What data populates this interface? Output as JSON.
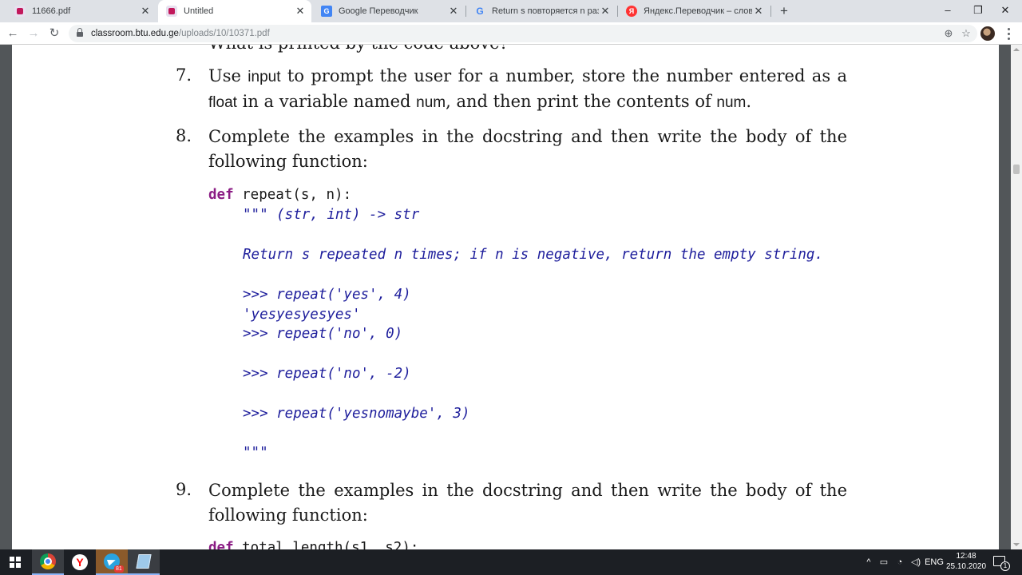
{
  "tabs": [
    {
      "title": "11666.pdf",
      "icon": "pdf-icon",
      "active": false
    },
    {
      "title": "Untitled",
      "icon": "pdf-icon",
      "active": true
    },
    {
      "title": "Google Переводчик",
      "icon": "google-translate-icon",
      "active": false
    },
    {
      "title": "Return s повторяется n раз; если",
      "icon": "google-icon",
      "active": false
    },
    {
      "title": "Яндекс.Переводчик – словарь и",
      "icon": "yandex-translate-icon",
      "active": false
    }
  ],
  "window_controls": {
    "minimize": "–",
    "maximize": "❐",
    "close": "✕"
  },
  "toolbar": {
    "back": "←",
    "forward": "→",
    "reload": "↻",
    "url_host": "classroom.btu.edu.ge",
    "url_path": "/uploads/10/10371.pdf",
    "zoom_icon": "⊕",
    "star_icon": "☆"
  },
  "document": {
    "cut_line": "What is printed by the code above?",
    "item7": {
      "number": "7.",
      "t1": "Use ",
      "c1": "input",
      "t2": " to prompt the user for a number, store the number entered as a ",
      "c2": "float",
      "t3": " in a variable named ",
      "c3": "num",
      "t4": ", and then print the contents of ",
      "c4": "num",
      "t5": "."
    },
    "item8": {
      "number": "8.",
      "text": "Complete the examples in the docstring and then write the body of the following function:",
      "code": {
        "def_kw": "def",
        "signature": " repeat(s, n):",
        "doc_open": "\"\"\" (str, int) -> str",
        "doc_desc": "Return s repeated n times; if n is negative, return the empty string.",
        "ex1": ">>> repeat('yes', 4)",
        "ex1_result": "'yesyesyesyes'",
        "ex2": ">>> repeat('no', 0)",
        "ex3": ">>> repeat('no', -2)",
        "ex4": ">>> repeat('yesnomaybe', 3)",
        "doc_close": "\"\"\""
      }
    },
    "item9": {
      "number": "9.",
      "text": "Complete the examples in the docstring and then write the body of the following function:",
      "code_def_kw": "def",
      "code_signature": " total_length(s1, s2):"
    }
  },
  "taskbar": {
    "apps": [
      "chrome-icon",
      "yandex-browser-icon",
      "telegram-icon",
      "sticky-notes-icon"
    ],
    "telegram_badge": "81",
    "language": "ENG",
    "time": "12:48",
    "date": "25.10.2020",
    "notification_count": "1"
  }
}
